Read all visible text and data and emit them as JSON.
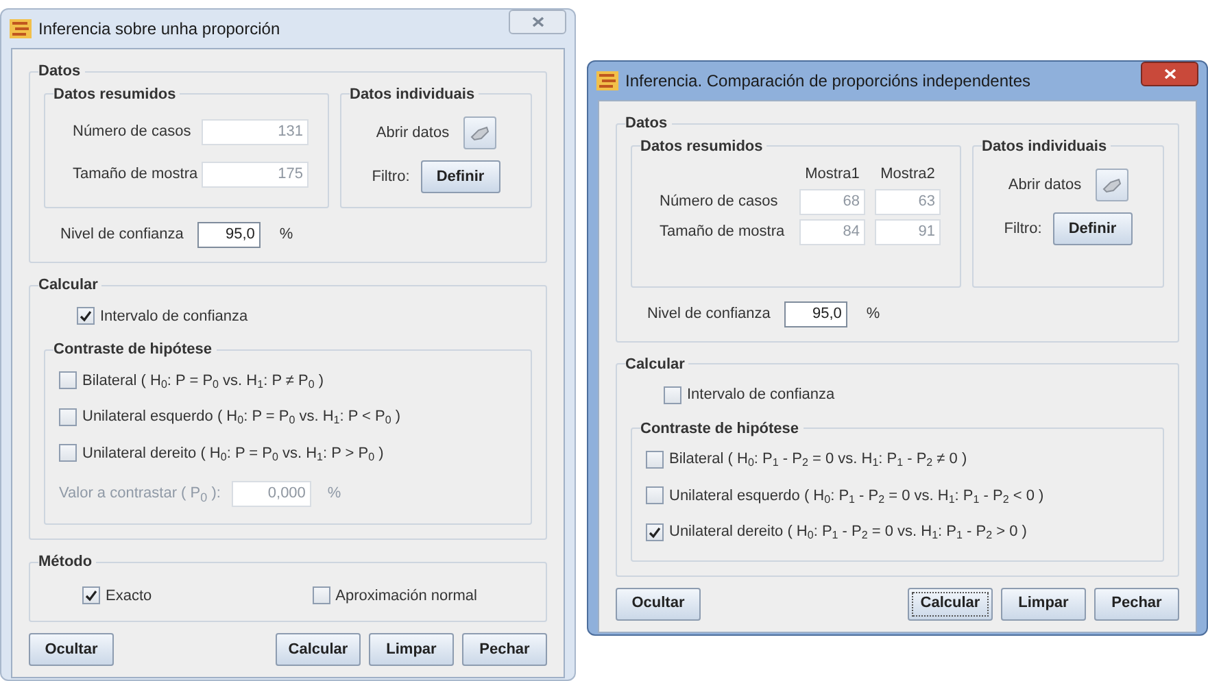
{
  "windows": [
    {
      "title": "Inferencia sobre unha proporción",
      "active": false,
      "datos": {
        "title": "Datos",
        "resumidos": {
          "title": "Datos resumidos",
          "disabled": true,
          "rows": [
            {
              "label": "Número de casos",
              "values": [
                "131"
              ]
            },
            {
              "label": "Tamaño de mostra",
              "values": [
                "175"
              ]
            }
          ]
        },
        "individuais": {
          "title": "Datos individuais",
          "open_label": "Abrir datos",
          "filter_label": "Filtro:",
          "filter_button": "Definir"
        },
        "confidence": {
          "label": "Nivel de confianza",
          "value": "95,0",
          "unit": "%"
        }
      },
      "calcular": {
        "title": "Calcular",
        "interval": {
          "label": "Intervalo de confianza",
          "checked": true
        },
        "contraste": {
          "title": "Contraste de hipótese",
          "options": [
            {
              "label": "Bilateral ( H$_{0}$: P = P$_{0}$ vs. H$_{1}$: P ≠ P$_{0}$ )",
              "checked": false
            },
            {
              "label": "Unilateral esquerdo ( H$_{0}$: P = P$_{0}$ vs. H$_{1}$: P < P$_{0}$ )",
              "checked": false
            },
            {
              "label": "Unilateral dereito ( H$_{0}$: P = P$_{0}$ vs. H$_{1}$: P > P$_{0}$ )",
              "checked": false
            }
          ],
          "value_field": {
            "label": "Valor a contrastar ( P$_{0}$ ):",
            "value": "0,000",
            "unit": "%",
            "disabled": true
          }
        }
      },
      "metodo": {
        "title": "Método",
        "options": [
          {
            "label": "Exacto",
            "checked": true
          },
          {
            "label": "Aproximación normal",
            "checked": false
          }
        ]
      },
      "buttons": [
        {
          "label": "Ocultar",
          "focused": false
        },
        {
          "label": "Calcular",
          "focused": false
        },
        {
          "label": "Limpar",
          "focused": false
        },
        {
          "label": "Pechar",
          "focused": false
        }
      ]
    },
    {
      "title": "Inferencia. Comparación de proporcións independentes",
      "active": true,
      "datos": {
        "title": "Datos",
        "resumidos": {
          "title": "Datos resumidos",
          "disabled": true,
          "columns": [
            "Mostra1",
            "Mostra2"
          ],
          "rows": [
            {
              "label": "Número de casos",
              "values": [
                "68",
                "63"
              ]
            },
            {
              "label": "Tamaño de mostra",
              "values": [
                "84",
                "91"
              ]
            }
          ]
        },
        "individuais": {
          "title": "Datos individuais",
          "open_label": "Abrir datos",
          "filter_label": "Filtro:",
          "filter_button": "Definir"
        },
        "confidence": {
          "label": "Nivel de confianza",
          "value": "95,0",
          "unit": "%"
        }
      },
      "calcular": {
        "title": "Calcular",
        "interval": {
          "label": "Intervalo de confianza",
          "checked": false
        },
        "contraste": {
          "title": "Contraste de hipótese",
          "options": [
            {
              "label": "Bilateral ( H$_{0}$: P$_{1}$ - P$_{2}$ = 0 vs. H$_{1}$: P$_{1}$ - P$_{2}$ ≠ 0 )",
              "checked": false
            },
            {
              "label": "Unilateral esquerdo ( H$_{0}$: P$_{1}$ - P$_{2}$ = 0 vs. H$_{1}$: P$_{1}$ - P$_{2}$ < 0 )",
              "checked": false
            },
            {
              "label": "Unilateral dereito ( H$_{0}$: P$_{1}$ - P$_{2}$ = 0 vs. H$_{1}$: P$_{1}$ - P$_{2}$ > 0 )",
              "checked": true
            }
          ]
        }
      },
      "buttons": [
        {
          "label": "Ocultar",
          "focused": false
        },
        {
          "label": "Calcular",
          "focused": true
        },
        {
          "label": "Limpar",
          "focused": false
        },
        {
          "label": "Pechar",
          "focused": false
        }
      ]
    }
  ]
}
